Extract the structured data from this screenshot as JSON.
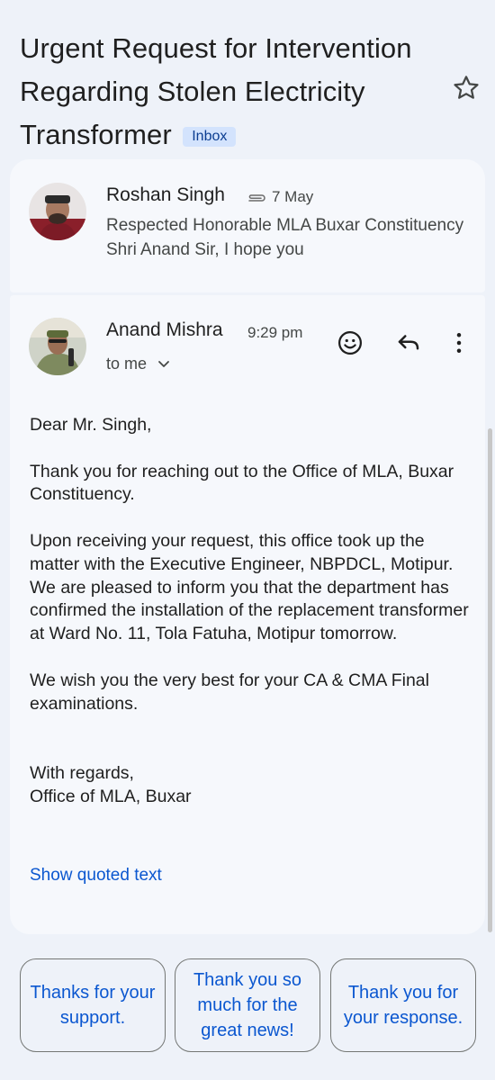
{
  "subject": "Urgent Request for Intervention Regarding Stolen Electricity Transformer",
  "label": "Inbox",
  "thread": {
    "collapsed": {
      "sender": "Roshan Singh",
      "date": "7 May",
      "snippet": "Respected Honorable MLA Buxar Constituency Shri Anand Sir, I hope you",
      "icons": [
        "attachment-icon"
      ]
    },
    "expanded": {
      "sender": "Anand Mishra",
      "time": "9:29 pm",
      "recipient": "to me",
      "body": {
        "greeting": "Dear Mr. Singh,",
        "p1": "Thank you for reaching out to the Office of MLA, Buxar Constituency.",
        "p2": "Upon receiving your request, this office took up the matter with the Executive Engineer, NBPDCL, Motipur. We are pleased to inform you that the department has confirmed the installation of the replacement transformer at Ward No. 11, Tola Fatuha, Motipur tomorrow.",
        "p3": "We wish you the very best for your CA & CMA Final examinations.",
        "closing": "With regards,",
        "signature": "Office of MLA, Buxar"
      },
      "show_quoted": "Show quoted text",
      "icons": [
        "emoji-react-icon",
        "reply-icon",
        "more-vert-icon",
        "chevron-down-icon"
      ]
    }
  },
  "smart_replies": [
    "Thanks for your support.",
    "Thank you so much for the great news!",
    "Thank you for your response."
  ],
  "colors": {
    "background": "#eef2f9",
    "card": "#f6f8fc",
    "accent_blue": "#0b57d0",
    "chip_bg": "#d3e3fd"
  }
}
